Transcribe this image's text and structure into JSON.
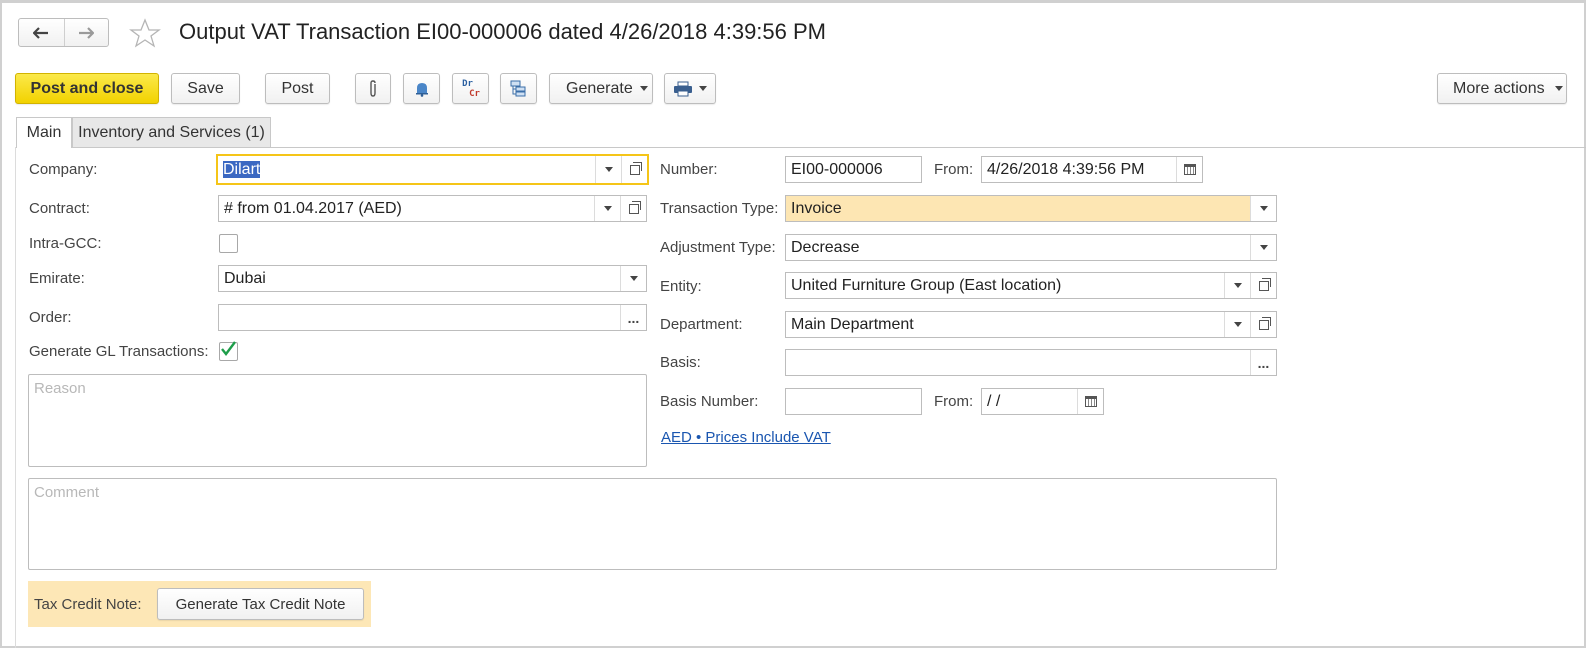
{
  "window": {
    "title": "Output VAT Transaction EI00-000006 dated 4/26/2018 4:39:56 PM"
  },
  "toolbar": {
    "post_close_label": "Post and close",
    "save_label": "Save",
    "post_label": "Post",
    "drcr_top": "Dr",
    "drcr_bottom": "Cr",
    "generate_label": "Generate",
    "more_actions_label": "More actions"
  },
  "tabs": [
    {
      "label": "Main",
      "active": true
    },
    {
      "label": "Inventory and Services (1)",
      "active": false
    }
  ],
  "left": {
    "company_label": "Company:",
    "company_value": "Dilart",
    "contract_label": "Contract:",
    "contract_value": "#  from 01.04.2017 (AED)",
    "intra_gcc_label": "Intra-GCC:",
    "intra_gcc_checked": false,
    "emirate_label": "Emirate:",
    "emirate_value": "Dubai",
    "order_label": "Order:",
    "order_value": "",
    "generate_gl_label": "Generate GL Transactions:",
    "generate_gl_checked": true,
    "reason_placeholder": "Reason"
  },
  "right": {
    "number_label": "Number:",
    "number_value": "EI00-000006",
    "from_label": "From:",
    "from_value": "4/26/2018  4:39:56 PM",
    "transaction_type_label": "Transaction Type:",
    "transaction_type_value": "Invoice",
    "adjustment_type_label": "Adjustment Type:",
    "adjustment_type_value": "Decrease",
    "entity_label": "Entity:",
    "entity_value": "United Furniture Group (East location)",
    "department_label": "Department:",
    "department_value": "Main Department",
    "basis_label": "Basis:",
    "basis_value": "",
    "basis_number_label": "Basis Number:",
    "basis_number_value": "",
    "basis_from_label": "From:",
    "basis_from_value": " /  /",
    "currency_link": "AED • Prices Include VAT"
  },
  "comment_placeholder": "Comment",
  "tax_credit": {
    "label": "Tax Credit Note:",
    "button_label": "Generate Tax Credit Note"
  },
  "colors": {
    "primary_button": "#f2d200",
    "highlight_field": "#fde6b3",
    "tax_panel": "#fde7b6",
    "focus_border": "#f5c518",
    "link": "#1a56b0",
    "selection": "#3b68c2"
  },
  "icons": {
    "back": "arrow-left-icon",
    "forward": "arrow-right-icon",
    "favorite": "star-icon",
    "attach": "paperclip-icon",
    "reminder": "bell-icon",
    "journal": "dr-cr-icon",
    "structure": "hierarchy-icon",
    "print": "printer-icon"
  }
}
